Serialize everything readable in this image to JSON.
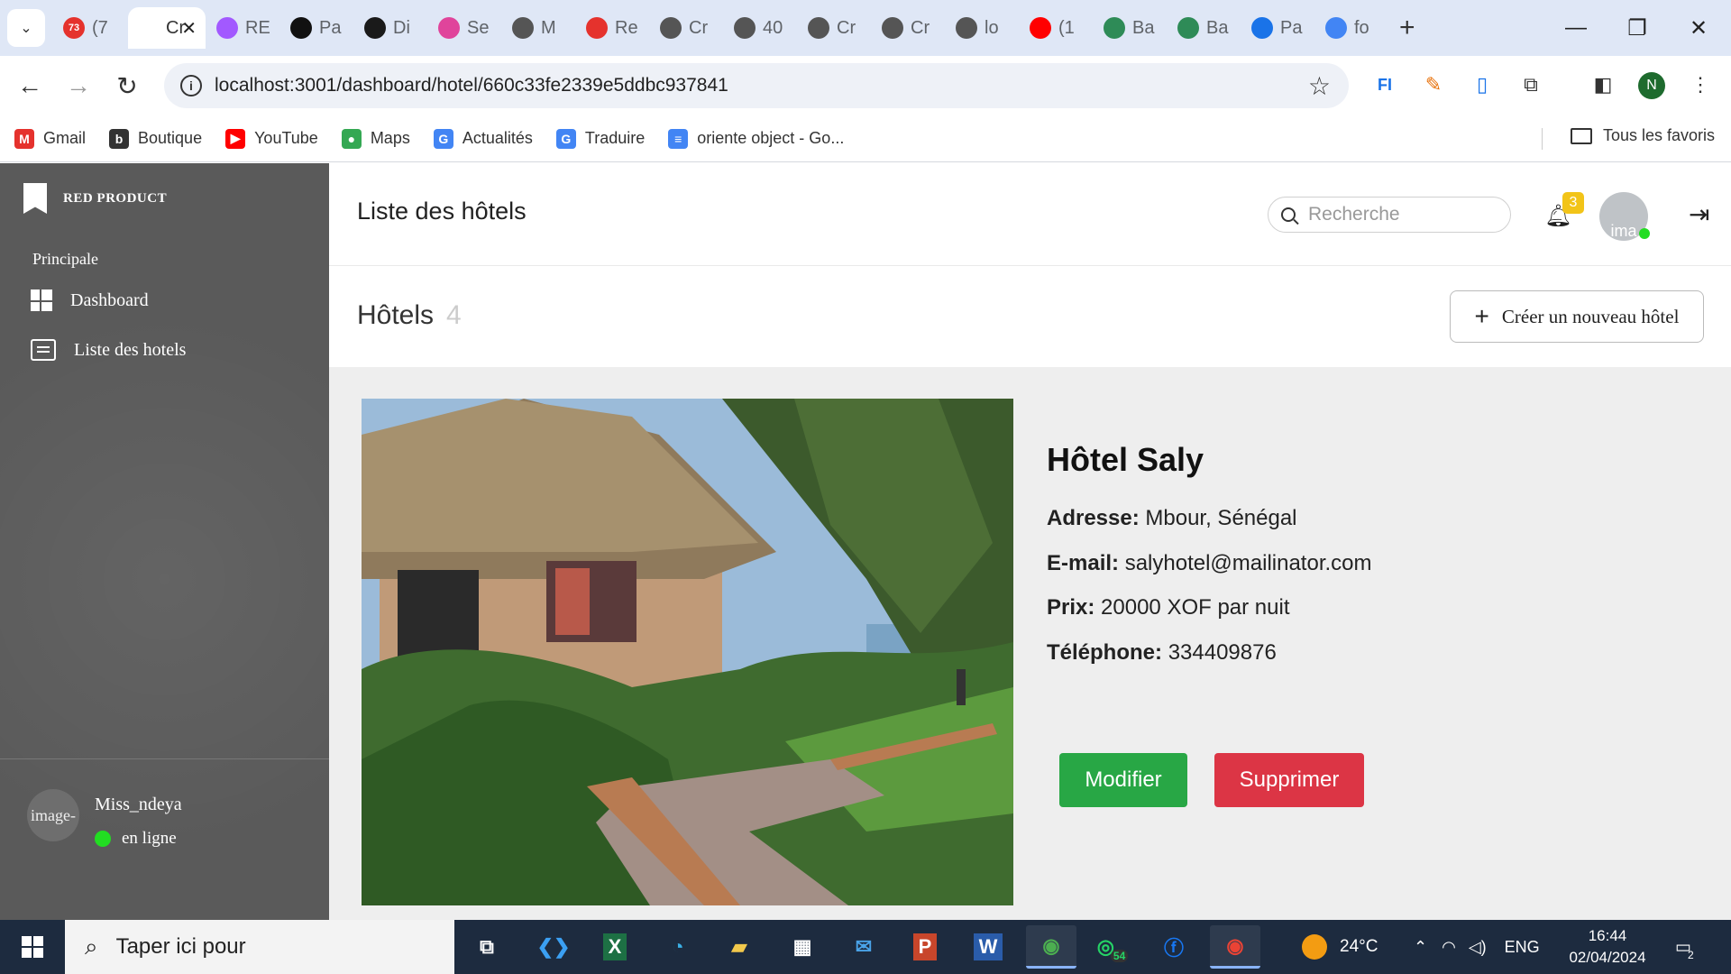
{
  "browser": {
    "tabs": [
      {
        "label": "(7",
        "favicon": "gmail-red-badge-icon",
        "color": "#e5322d",
        "badge": "73"
      },
      {
        "label": "Cr",
        "favicon": "page-icon",
        "color": "#ffffff",
        "active": true
      },
      {
        "label": "RE",
        "favicon": "figma-icon",
        "color": "#a259ff"
      },
      {
        "label": "Pa",
        "favicon": "play-icon",
        "color": "#111111"
      },
      {
        "label": "Di",
        "favicon": "dark-circle-icon",
        "color": "#1a1a1a"
      },
      {
        "label": "Se",
        "favicon": "flower-icon",
        "color": "#e0449b"
      },
      {
        "label": "M",
        "favicon": "globe-icon",
        "color": "#555555"
      },
      {
        "label": "Re",
        "favicon": "gmail-icon",
        "color": "#e5322d"
      },
      {
        "label": "Cr",
        "favicon": "globe-icon",
        "color": "#555555"
      },
      {
        "label": "40",
        "favicon": "globe-icon",
        "color": "#555555"
      },
      {
        "label": "Cr",
        "favicon": "globe-icon",
        "color": "#555555"
      },
      {
        "label": "Cr",
        "favicon": "globe-icon",
        "color": "#555555"
      },
      {
        "label": "lo",
        "favicon": "globe-icon",
        "color": "#555555"
      },
      {
        "label": "(1",
        "favicon": "youtube-icon",
        "color": "#ff0000"
      },
      {
        "label": "Ba",
        "favicon": "bank-icon",
        "color": "#2e8b57"
      },
      {
        "label": "Ba",
        "favicon": "bank-icon",
        "color": "#2e8b57"
      },
      {
        "label": "Pa",
        "favicon": "gear-icon",
        "color": "#1a73e8"
      },
      {
        "label": "fo",
        "favicon": "google-icon",
        "color": "#4285f4"
      }
    ],
    "tab_close": "✕",
    "new_tab": "+",
    "url": "localhost:3001/dashboard/hotel/660c33fe2339e5ddbc937841",
    "profile_initial": "N",
    "bookmarks": [
      {
        "label": "Gmail",
        "icon": "gmail-icon",
        "color": "#e5322d",
        "glyph": "M"
      },
      {
        "label": "Boutique",
        "icon": "shopping-bag-icon",
        "color": "#333333",
        "glyph": "b"
      },
      {
        "label": "YouTube",
        "icon": "youtube-icon",
        "color": "#ff0000",
        "glyph": "▶"
      },
      {
        "label": "Maps",
        "icon": "map-pin-icon",
        "color": "#34a853",
        "glyph": "●"
      },
      {
        "label": "Actualités",
        "icon": "news-icon",
        "color": "#4285f4",
        "glyph": "G"
      },
      {
        "label": "Traduire",
        "icon": "translate-icon",
        "color": "#4285f4",
        "glyph": "G"
      },
      {
        "label": "oriente object - Go...",
        "icon": "docs-icon",
        "color": "#4285f4",
        "glyph": "≡"
      }
    ],
    "all_bookmarks": "Tous les favoris"
  },
  "sidebar": {
    "brand": "RED PRODUCT",
    "section": "Principale",
    "items": [
      {
        "label": "Dashboard",
        "icon": "dashboard-icon"
      },
      {
        "label": "Liste des hotels",
        "icon": "list-icon"
      }
    ],
    "user": {
      "avatar_alt": "image-",
      "name": "Miss_ndeya",
      "status": "en ligne"
    }
  },
  "topbar": {
    "title": "Liste des hôtels",
    "search_placeholder": "Recherche",
    "notification_count": "3",
    "avatar_alt": "ima"
  },
  "subheader": {
    "title": "Hôtels",
    "count": "4",
    "create_label": "Créer un nouveau hôtel"
  },
  "hotel": {
    "name": "Hôtel Saly",
    "address_label": "Adresse:",
    "address": "Mbour, Sénégal",
    "email_label": "E-mail:",
    "email": "salyhotel@mailinator.com",
    "price_label": "Prix:",
    "price": "20000 XOF par nuit",
    "phone_label": "Téléphone:",
    "phone": "334409876",
    "edit_label": "Modifier",
    "delete_label": "Supprimer"
  },
  "taskbar": {
    "search_placeholder": "Taper ici pour",
    "whatsapp_badge": "54",
    "temperature": "24°C",
    "language": "ENG",
    "time": "16:44",
    "date": "02/04/2024",
    "notifications": "2"
  },
  "colors": {
    "sidebar_bg": "#5a5a5a",
    "edit_button": "#28a745",
    "delete_button": "#dc3545",
    "badge": "#f2c418",
    "online": "#22dd22"
  }
}
